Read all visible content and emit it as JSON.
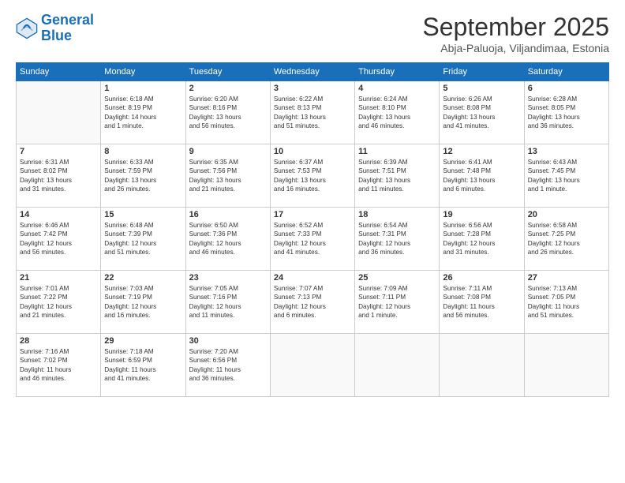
{
  "header": {
    "logo_general": "General",
    "logo_blue": "Blue",
    "month_title": "September 2025",
    "subtitle": "Abja-Paluoja, Viljandimaa, Estonia"
  },
  "weekdays": [
    "Sunday",
    "Monday",
    "Tuesday",
    "Wednesday",
    "Thursday",
    "Friday",
    "Saturday"
  ],
  "weeks": [
    [
      {
        "day": "",
        "info": ""
      },
      {
        "day": "1",
        "info": "Sunrise: 6:18 AM\nSunset: 8:19 PM\nDaylight: 14 hours\nand 1 minute."
      },
      {
        "day": "2",
        "info": "Sunrise: 6:20 AM\nSunset: 8:16 PM\nDaylight: 13 hours\nand 56 minutes."
      },
      {
        "day": "3",
        "info": "Sunrise: 6:22 AM\nSunset: 8:13 PM\nDaylight: 13 hours\nand 51 minutes."
      },
      {
        "day": "4",
        "info": "Sunrise: 6:24 AM\nSunset: 8:10 PM\nDaylight: 13 hours\nand 46 minutes."
      },
      {
        "day": "5",
        "info": "Sunrise: 6:26 AM\nSunset: 8:08 PM\nDaylight: 13 hours\nand 41 minutes."
      },
      {
        "day": "6",
        "info": "Sunrise: 6:28 AM\nSunset: 8:05 PM\nDaylight: 13 hours\nand 36 minutes."
      }
    ],
    [
      {
        "day": "7",
        "info": "Sunrise: 6:31 AM\nSunset: 8:02 PM\nDaylight: 13 hours\nand 31 minutes."
      },
      {
        "day": "8",
        "info": "Sunrise: 6:33 AM\nSunset: 7:59 PM\nDaylight: 13 hours\nand 26 minutes."
      },
      {
        "day": "9",
        "info": "Sunrise: 6:35 AM\nSunset: 7:56 PM\nDaylight: 13 hours\nand 21 minutes."
      },
      {
        "day": "10",
        "info": "Sunrise: 6:37 AM\nSunset: 7:53 PM\nDaylight: 13 hours\nand 16 minutes."
      },
      {
        "day": "11",
        "info": "Sunrise: 6:39 AM\nSunset: 7:51 PM\nDaylight: 13 hours\nand 11 minutes."
      },
      {
        "day": "12",
        "info": "Sunrise: 6:41 AM\nSunset: 7:48 PM\nDaylight: 13 hours\nand 6 minutes."
      },
      {
        "day": "13",
        "info": "Sunrise: 6:43 AM\nSunset: 7:45 PM\nDaylight: 13 hours\nand 1 minute."
      }
    ],
    [
      {
        "day": "14",
        "info": "Sunrise: 6:46 AM\nSunset: 7:42 PM\nDaylight: 12 hours\nand 56 minutes."
      },
      {
        "day": "15",
        "info": "Sunrise: 6:48 AM\nSunset: 7:39 PM\nDaylight: 12 hours\nand 51 minutes."
      },
      {
        "day": "16",
        "info": "Sunrise: 6:50 AM\nSunset: 7:36 PM\nDaylight: 12 hours\nand 46 minutes."
      },
      {
        "day": "17",
        "info": "Sunrise: 6:52 AM\nSunset: 7:33 PM\nDaylight: 12 hours\nand 41 minutes."
      },
      {
        "day": "18",
        "info": "Sunrise: 6:54 AM\nSunset: 7:31 PM\nDaylight: 12 hours\nand 36 minutes."
      },
      {
        "day": "19",
        "info": "Sunrise: 6:56 AM\nSunset: 7:28 PM\nDaylight: 12 hours\nand 31 minutes."
      },
      {
        "day": "20",
        "info": "Sunrise: 6:58 AM\nSunset: 7:25 PM\nDaylight: 12 hours\nand 26 minutes."
      }
    ],
    [
      {
        "day": "21",
        "info": "Sunrise: 7:01 AM\nSunset: 7:22 PM\nDaylight: 12 hours\nand 21 minutes."
      },
      {
        "day": "22",
        "info": "Sunrise: 7:03 AM\nSunset: 7:19 PM\nDaylight: 12 hours\nand 16 minutes."
      },
      {
        "day": "23",
        "info": "Sunrise: 7:05 AM\nSunset: 7:16 PM\nDaylight: 12 hours\nand 11 minutes."
      },
      {
        "day": "24",
        "info": "Sunrise: 7:07 AM\nSunset: 7:13 PM\nDaylight: 12 hours\nand 6 minutes."
      },
      {
        "day": "25",
        "info": "Sunrise: 7:09 AM\nSunset: 7:11 PM\nDaylight: 12 hours\nand 1 minute."
      },
      {
        "day": "26",
        "info": "Sunrise: 7:11 AM\nSunset: 7:08 PM\nDaylight: 11 hours\nand 56 minutes."
      },
      {
        "day": "27",
        "info": "Sunrise: 7:13 AM\nSunset: 7:05 PM\nDaylight: 11 hours\nand 51 minutes."
      }
    ],
    [
      {
        "day": "28",
        "info": "Sunrise: 7:16 AM\nSunset: 7:02 PM\nDaylight: 11 hours\nand 46 minutes."
      },
      {
        "day": "29",
        "info": "Sunrise: 7:18 AM\nSunset: 6:59 PM\nDaylight: 11 hours\nand 41 minutes."
      },
      {
        "day": "30",
        "info": "Sunrise: 7:20 AM\nSunset: 6:56 PM\nDaylight: 11 hours\nand 36 minutes."
      },
      {
        "day": "",
        "info": ""
      },
      {
        "day": "",
        "info": ""
      },
      {
        "day": "",
        "info": ""
      },
      {
        "day": "",
        "info": ""
      }
    ]
  ]
}
